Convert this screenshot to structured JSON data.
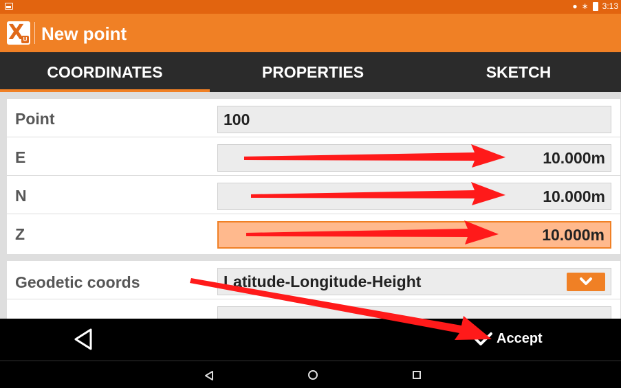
{
  "status_bar": {
    "time": "3:13",
    "icons": [
      "image-icon",
      "location-pin-icon",
      "bluetooth-icon",
      "battery-icon"
    ]
  },
  "app_bar": {
    "title": "New point",
    "logo_icon": "app-logo-icon"
  },
  "tabs": [
    {
      "label": "COORDINATES",
      "selected": true
    },
    {
      "label": "PROPERTIES",
      "selected": false
    },
    {
      "label": "SKETCH",
      "selected": false
    }
  ],
  "form": {
    "point": {
      "label": "Point",
      "value": "100"
    },
    "e": {
      "label": "E",
      "value": "10.000m"
    },
    "n": {
      "label": "N",
      "value": "10.000m"
    },
    "z": {
      "label": "Z",
      "value": "10.000m"
    },
    "geodetic": {
      "label": "Geodetic coords",
      "value": "Latitude-Longitude-Height"
    }
  },
  "bottom_bar": {
    "accept_label": "Accept"
  },
  "colors": {
    "accent": "#f08025",
    "status_bar": "#e2640f",
    "tab_bar": "#2b2b2b",
    "active_field": "#ffb98d",
    "annotation_arrow": "#ff1a1a"
  }
}
